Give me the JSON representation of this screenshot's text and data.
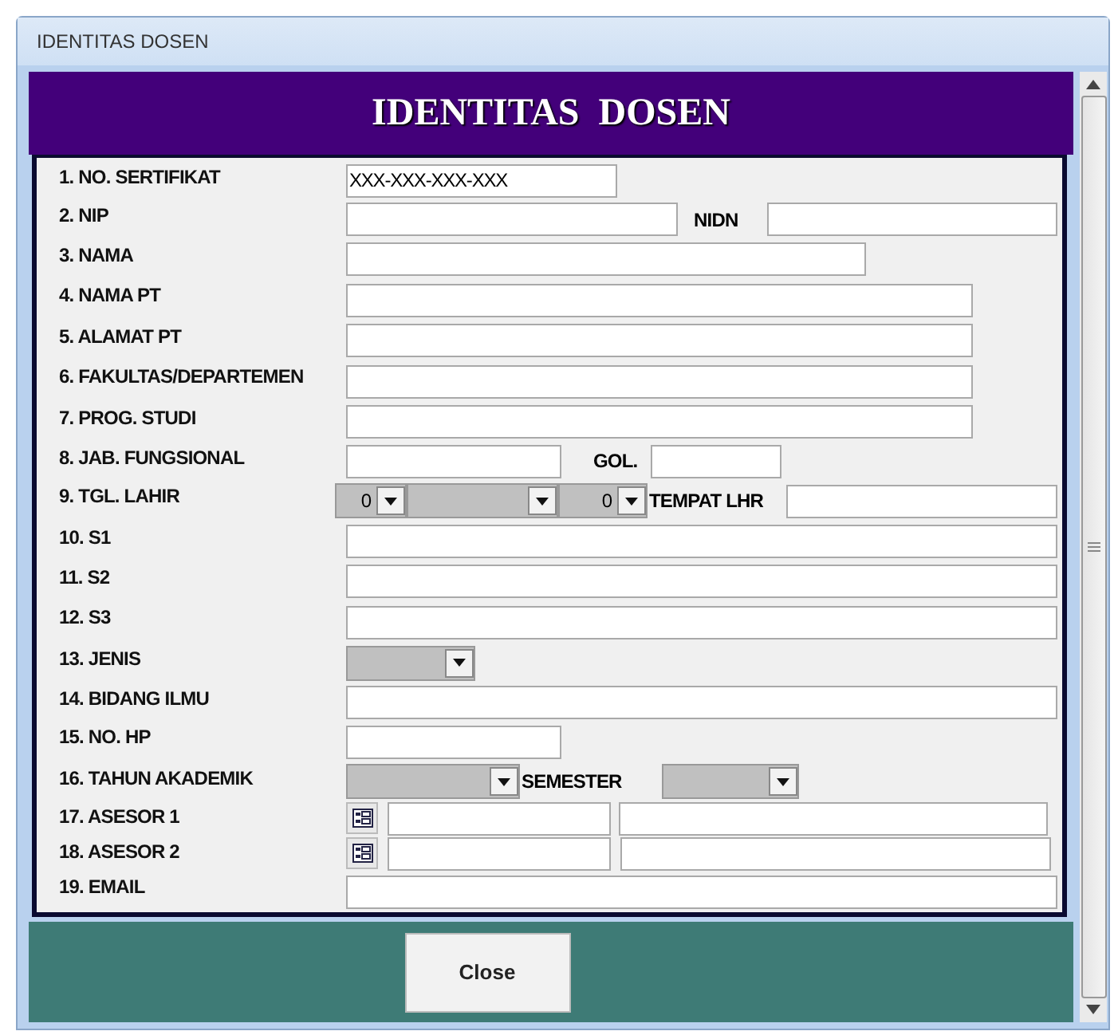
{
  "window": {
    "title": "IDENTITAS DOSEN"
  },
  "header": {
    "title": "IDENTITAS  DOSEN"
  },
  "rows": [
    {
      "label": "1. NO. SERTIFIKAT",
      "items": [
        {
          "kind": "text",
          "value": "XXX-XXX-XXX-XXX"
        }
      ]
    },
    {
      "label": "2. NIP",
      "items": [
        {
          "kind": "text"
        },
        {
          "kind": "label",
          "text": "NIDN"
        },
        {
          "kind": "text"
        }
      ]
    },
    {
      "label": "3. NAMA",
      "items": [
        {
          "kind": "text"
        }
      ]
    },
    {
      "label": "4. NAMA PT",
      "items": [
        {
          "kind": "text"
        }
      ]
    },
    {
      "label": "5. ALAMAT PT",
      "items": [
        {
          "kind": "text"
        }
      ]
    },
    {
      "label": "6. FAKULTAS/DEPARTEMEN",
      "items": [
        {
          "kind": "text"
        }
      ]
    },
    {
      "label": "7. PROG. STUDI",
      "items": [
        {
          "kind": "text"
        }
      ]
    },
    {
      "label": "8. JAB. FUNGSIONAL",
      "items": [
        {
          "kind": "text"
        },
        {
          "kind": "label",
          "text": "GOL."
        },
        {
          "kind": "text"
        }
      ]
    },
    {
      "label": "9. TGL. LAHIR",
      "items": [
        {
          "kind": "combo",
          "value": "0"
        },
        {
          "kind": "combo"
        },
        {
          "kind": "combo",
          "value": "0"
        },
        {
          "kind": "label",
          "text": "TEMPAT LHR"
        },
        {
          "kind": "text"
        }
      ]
    },
    {
      "label": "10. S1",
      "items": [
        {
          "kind": "text"
        }
      ]
    },
    {
      "label": "11. S2",
      "items": [
        {
          "kind": "text"
        }
      ]
    },
    {
      "label": "12. S3",
      "items": [
        {
          "kind": "text"
        }
      ]
    },
    {
      "label": "13. JENIS",
      "items": [
        {
          "kind": "combo"
        }
      ]
    },
    {
      "label": "14. BIDANG ILMU",
      "items": [
        {
          "kind": "text"
        }
      ]
    },
    {
      "label": "15. NO. HP",
      "items": [
        {
          "kind": "text"
        }
      ]
    },
    {
      "label": "16. TAHUN AKADEMIK",
      "items": [
        {
          "kind": "combo"
        },
        {
          "kind": "label",
          "text": "SEMESTER"
        },
        {
          "kind": "combo"
        }
      ]
    },
    {
      "label": "17. ASESOR 1",
      "items": [
        {
          "kind": "lookup"
        },
        {
          "kind": "text"
        },
        {
          "kind": "text"
        }
      ]
    },
    {
      "label": "18. ASESOR 2",
      "items": [
        {
          "kind": "lookup"
        },
        {
          "kind": "text"
        },
        {
          "kind": "text"
        }
      ]
    },
    {
      "label": "19. EMAIL",
      "items": [
        {
          "kind": "text"
        }
      ]
    }
  ],
  "footer": {
    "button": "Close"
  }
}
